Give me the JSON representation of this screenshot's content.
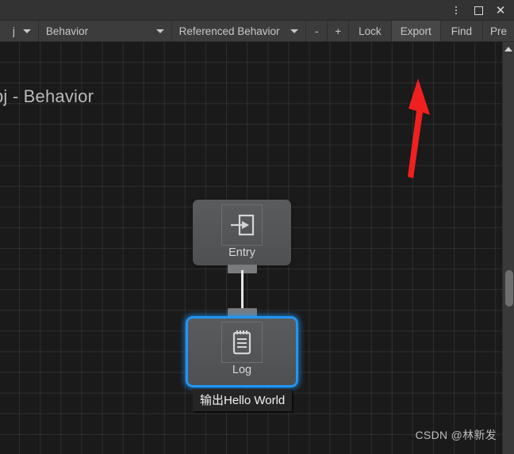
{
  "window": {
    "controls": [
      {
        "name": "more-options",
        "glyph": "kebab"
      },
      {
        "name": "maximize",
        "glyph": "square"
      },
      {
        "name": "close",
        "glyph": "x"
      }
    ]
  },
  "toolbar": {
    "partial_left_label": "j",
    "behavior_label": "Behavior",
    "referenced_behavior_label": "Referenced Behavior",
    "minus_label": "-",
    "plus_label": "+",
    "lock_label": "Lock",
    "export_label": "Export",
    "find_label": "Find",
    "pre_label": "Pre"
  },
  "canvas": {
    "title": "bj - Behavior",
    "nodes": [
      {
        "id": "entry",
        "label": "Entry",
        "icon": "enter-arrow-icon",
        "selected": false
      },
      {
        "id": "log",
        "label": "Log",
        "icon": "notepad-icon",
        "selected": true,
        "comment": "输出Hello World"
      }
    ]
  },
  "annotation": {
    "arrow_color": "#f02020",
    "points_to": "Export"
  },
  "watermark": "CSDN @林新发",
  "colors": {
    "selection": "#2196f3",
    "node_body": "#555658",
    "toolbar_bg": "#3c3c3c",
    "canvas_bg": "#1a1a1a",
    "annotation_red": "#f02020"
  }
}
